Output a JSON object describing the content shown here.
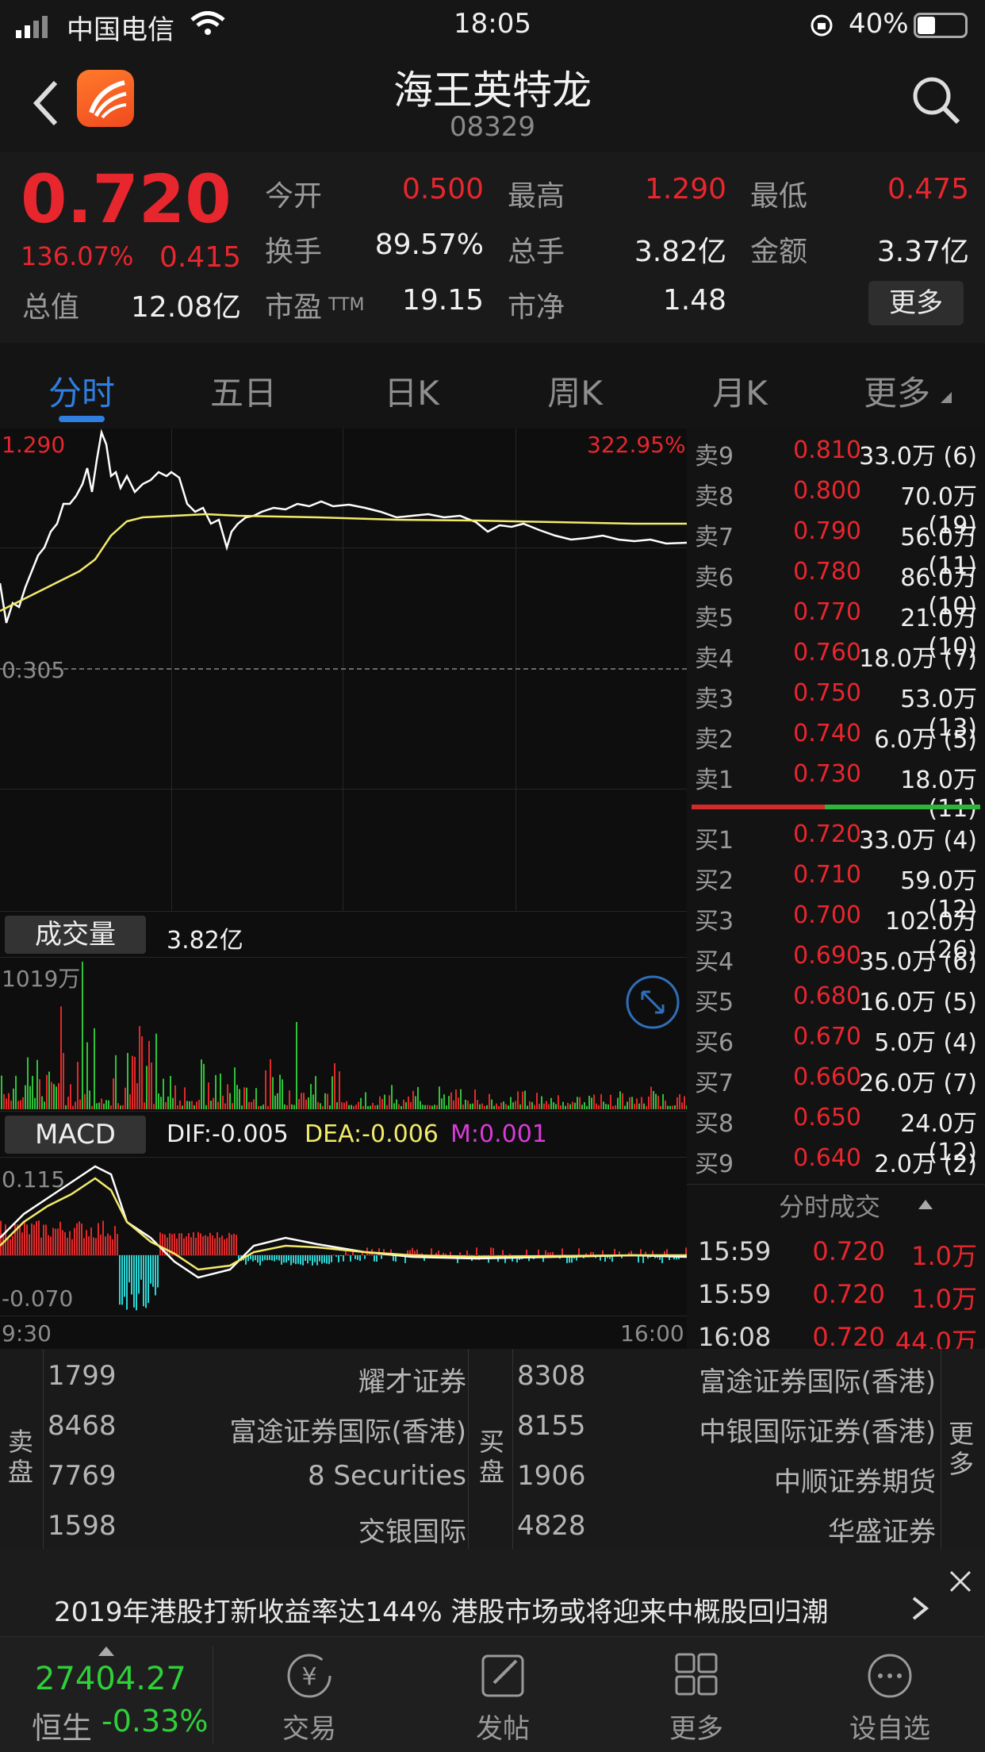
{
  "status_bar": {
    "carrier": "中国电信",
    "time": "18:05",
    "battery": "40%"
  },
  "header": {
    "title": "海王英特龙",
    "code": "08329"
  },
  "quote": {
    "price": "0.720",
    "change_pct": "136.07%",
    "change": "0.415",
    "rows": [
      [
        {
          "label": "今开",
          "value": "0.500"
        },
        {
          "label": "最高",
          "value": "1.290"
        },
        {
          "label": "最低",
          "value": "0.475"
        }
      ],
      [
        {
          "label": "换手",
          "value": "89.57%"
        },
        {
          "label": "总手",
          "value": "3.82亿"
        },
        {
          "label": "金额",
          "value": "3.37亿"
        }
      ]
    ],
    "total_value_label": "总值",
    "total_value": "12.08亿",
    "pe_label": "市盈",
    "pe_suffix": "TTM",
    "pe_value": "19.15",
    "pb_label": "市净",
    "pb_value": "1.48",
    "more_label": "更多"
  },
  "tabs": [
    {
      "label": "分时"
    },
    {
      "label": "五日"
    },
    {
      "label": "日K"
    },
    {
      "label": "周K"
    },
    {
      "label": "月K"
    },
    {
      "label": "更多"
    }
  ],
  "intraday": {
    "high_label": "1.290",
    "high_pct": "322.95%",
    "base_label": "0.305",
    "volume_btn": "成交量",
    "volume_total": "3.82亿",
    "volume_max": "1019万",
    "macd_btn": "MACD",
    "dif": "DIF:-0.005",
    "dea": "DEA:-0.006",
    "m": "M:0.001",
    "macd_top": "0.115",
    "macd_bottom": "-0.070",
    "time_start": "9:30",
    "time_end": "16:00"
  },
  "order_book": {
    "asks": [
      {
        "label": "卖9",
        "price": "0.810",
        "vol": "33.0万 (6)"
      },
      {
        "label": "卖8",
        "price": "0.800",
        "vol": "70.0万(19)"
      },
      {
        "label": "卖7",
        "price": "0.790",
        "vol": "56.0万(11)"
      },
      {
        "label": "卖6",
        "price": "0.780",
        "vol": "86.0万(10)"
      },
      {
        "label": "卖5",
        "price": "0.770",
        "vol": "21.0万(10)"
      },
      {
        "label": "卖4",
        "price": "0.760",
        "vol": "18.0万 (7)"
      },
      {
        "label": "卖3",
        "price": "0.750",
        "vol": "53.0万(13)"
      },
      {
        "label": "卖2",
        "price": "0.740",
        "vol": "6.0万 (5)"
      },
      {
        "label": "卖1",
        "price": "0.730",
        "vol": "18.0万(11)"
      }
    ],
    "bids": [
      {
        "label": "买1",
        "price": "0.720",
        "vol": "33.0万 (4)"
      },
      {
        "label": "买2",
        "price": "0.710",
        "vol": "59.0万(12)"
      },
      {
        "label": "买3",
        "price": "0.700",
        "vol": "102.0万(26)"
      },
      {
        "label": "买4",
        "price": "0.690",
        "vol": "35.0万 (6)"
      },
      {
        "label": "买5",
        "price": "0.680",
        "vol": "16.0万 (5)"
      },
      {
        "label": "买6",
        "price": "0.670",
        "vol": "5.0万 (4)"
      },
      {
        "label": "买7",
        "price": "0.660",
        "vol": "26.0万 (7)"
      },
      {
        "label": "买8",
        "price": "0.650",
        "vol": "24.0万(12)"
      },
      {
        "label": "买9",
        "price": "0.640",
        "vol": "2.0万 (2)"
      }
    ],
    "ticks_title": "分时成交",
    "ticks": [
      {
        "time": "15:59",
        "price": "0.720",
        "vol": "1.0万"
      },
      {
        "time": "15:59",
        "price": "0.720",
        "vol": "1.0万"
      },
      {
        "time": "16:08",
        "price": "0.720",
        "vol": "44.0万"
      }
    ]
  },
  "brokers": {
    "sell_label": "卖盘",
    "buy_label": "买盘",
    "more_label": "更多",
    "sell": [
      {
        "id": "1799",
        "name": "耀才证券"
      },
      {
        "id": "8468",
        "name": "富途证券国际(香港)"
      },
      {
        "id": "7769",
        "name": "8 Securities"
      },
      {
        "id": "1598",
        "name": "交银国际"
      }
    ],
    "buy": [
      {
        "id": "8308",
        "name": "富途证券国际(香港)"
      },
      {
        "id": "8155",
        "name": "中银国际证券(香港)"
      },
      {
        "id": "1906",
        "name": "中顺证券期货"
      },
      {
        "id": "4828",
        "name": "华盛证券"
      }
    ]
  },
  "news": {
    "text": "2019年港股打新收益率达144%   港股市场或将迎来中概股回归潮"
  },
  "nav": {
    "index_value": "27404.27",
    "index_name": "恒生",
    "index_change": "-0.33%",
    "items": [
      {
        "label": "交易"
      },
      {
        "label": "发帖"
      },
      {
        "label": "更多"
      },
      {
        "label": "设自选"
      }
    ]
  }
}
